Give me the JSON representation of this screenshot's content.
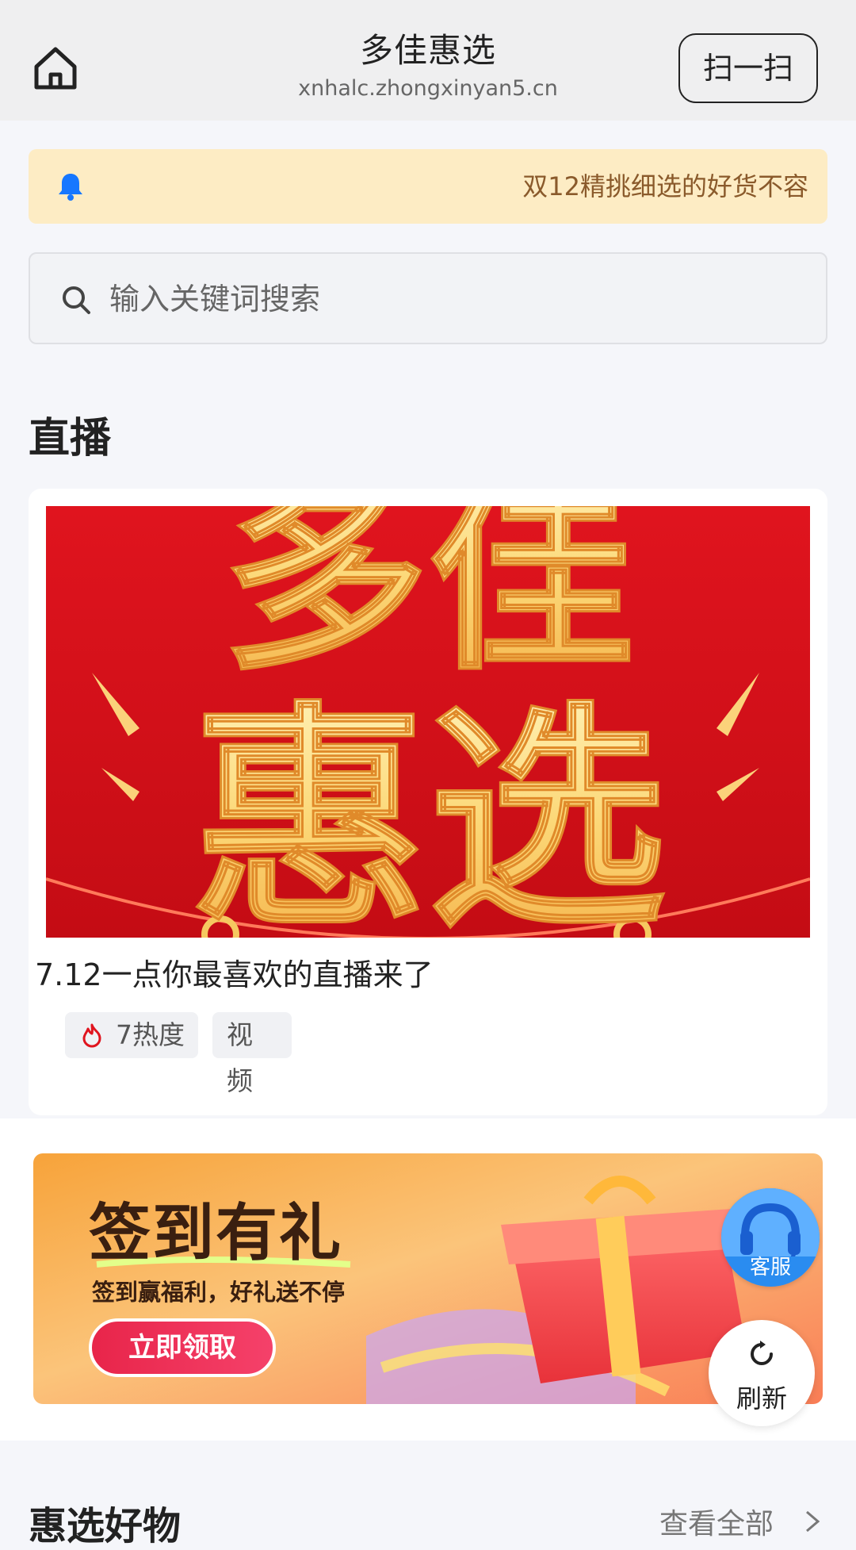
{
  "header": {
    "title": "多佳惠选",
    "subtitle": "xnhalc.zhongxinyan5.cn",
    "scan_label": "扫一扫"
  },
  "notice": {
    "text": "双12精挑细选的好货不容"
  },
  "search": {
    "placeholder": "输入关键词搜索"
  },
  "live": {
    "section_title": "直播",
    "cover_text_line1": "多佳",
    "cover_text_line2": "惠选",
    "title": "7.12一点你最喜欢的直播来了",
    "heat": "7热度",
    "tag": "视频"
  },
  "banner": {
    "title": "签到有礼",
    "subtitle": "签到赢福利，好礼送不停",
    "button": "立即领取"
  },
  "float": {
    "service_label": "客服",
    "refresh_label": "刷新"
  },
  "goods": {
    "section_title": "惠选好物",
    "view_all": "查看全部"
  },
  "colors": {
    "accent_red": "#e0141e",
    "notice_bg": "#fdecc4",
    "service_blue": "#2a8cf0"
  }
}
